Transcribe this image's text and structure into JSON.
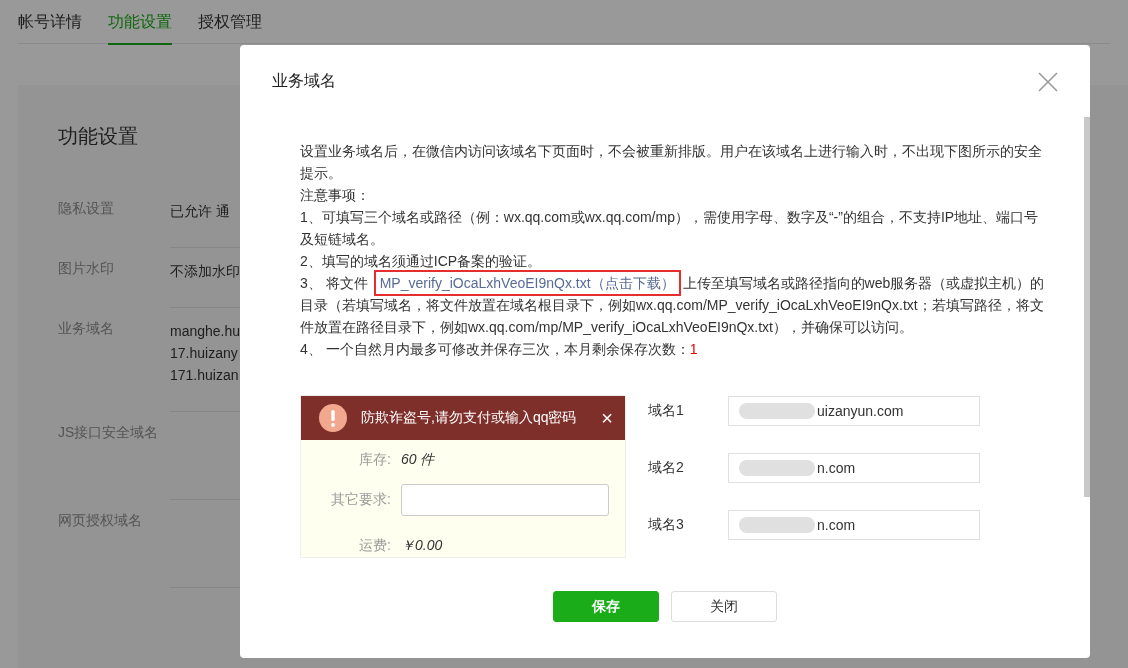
{
  "tabs": [
    {
      "label": "帐号详情",
      "selected": false
    },
    {
      "label": "功能设置",
      "selected": true
    },
    {
      "label": "授权管理",
      "selected": false
    }
  ],
  "settings": {
    "title": "功能设置",
    "rows": [
      {
        "label": "隐私设置",
        "values": [
          "已允许 通"
        ]
      },
      {
        "label": "图片水印",
        "values": [
          "不添加水印"
        ]
      },
      {
        "label": "业务域名",
        "values": [
          "manghe.hu",
          "17.huizany",
          "171.huizan"
        ]
      },
      {
        "label": "JS接口安全域名",
        "values": []
      },
      {
        "label": "网页授权域名",
        "values": []
      }
    ]
  },
  "dialog": {
    "title": "业务域名",
    "notes": [
      {
        "parts": [
          {
            "kind": "text",
            "text": "设置业务域名后，在微信内访问该域名下页面时，不会被重新排版。用户在该域名上进行输入时，不出现下图所示的安全提示。"
          }
        ]
      },
      {
        "parts": [
          {
            "kind": "text",
            "text": "注意事项："
          }
        ]
      },
      {
        "parts": [
          {
            "kind": "text",
            "text": "1、可填写三个域名或路径（例：wx.qq.com或wx.qq.com/mp），需使用字母、数字及“-”的组合，不支持IP地址、端口号及短链域名。"
          }
        ]
      },
      {
        "parts": [
          {
            "kind": "text",
            "text": "2、填写的域名须通过ICP备案的验证。"
          }
        ]
      },
      {
        "parts": [
          {
            "kind": "text",
            "text": "3、 将文件"
          },
          {
            "kind": "link",
            "text": "MP_verify_iOcaLxhVeoEI9nQx.txt（点击下载）",
            "highlighted": true
          },
          {
            "kind": "text",
            "text": "上传至填写域名或路径指向的web服务器（或虚拟主机）的目录（若填写域名，将文件放置在域名根目录下，例如wx.qq.com/MP_verify_iOcaLxhVeoEI9nQx.txt；若填写路径，将文件放置在路径目录下，例如wx.qq.com/mp/MP_verify_iOcaLxhVeoEI9nQx.txt），并确保可以访问。"
          }
        ]
      },
      {
        "parts": [
          {
            "kind": "text",
            "text": "4、 一个自然月内最多可修改并保存三次，本月剩余保存次数："
          },
          {
            "kind": "count",
            "text": "1"
          }
        ]
      }
    ],
    "example": {
      "warning": "防欺诈盗号,请勿支付或输入qq密码",
      "close": "×",
      "rows": [
        {
          "kind": "value",
          "label": "库存:",
          "value": "60 件"
        },
        {
          "kind": "input",
          "label": "其它要求:"
        },
        {
          "kind": "value",
          "label": "运费:",
          "value": "￥0.00"
        }
      ]
    },
    "domains": [
      {
        "label": "域名1",
        "value": "uizanyun.com"
      },
      {
        "label": "域名2",
        "value": "n.com"
      },
      {
        "label": "域名3",
        "value": "n.com"
      }
    ],
    "buttons": [
      {
        "label": "保存",
        "kind": "primary"
      },
      {
        "label": "关闭",
        "kind": "default"
      }
    ]
  }
}
